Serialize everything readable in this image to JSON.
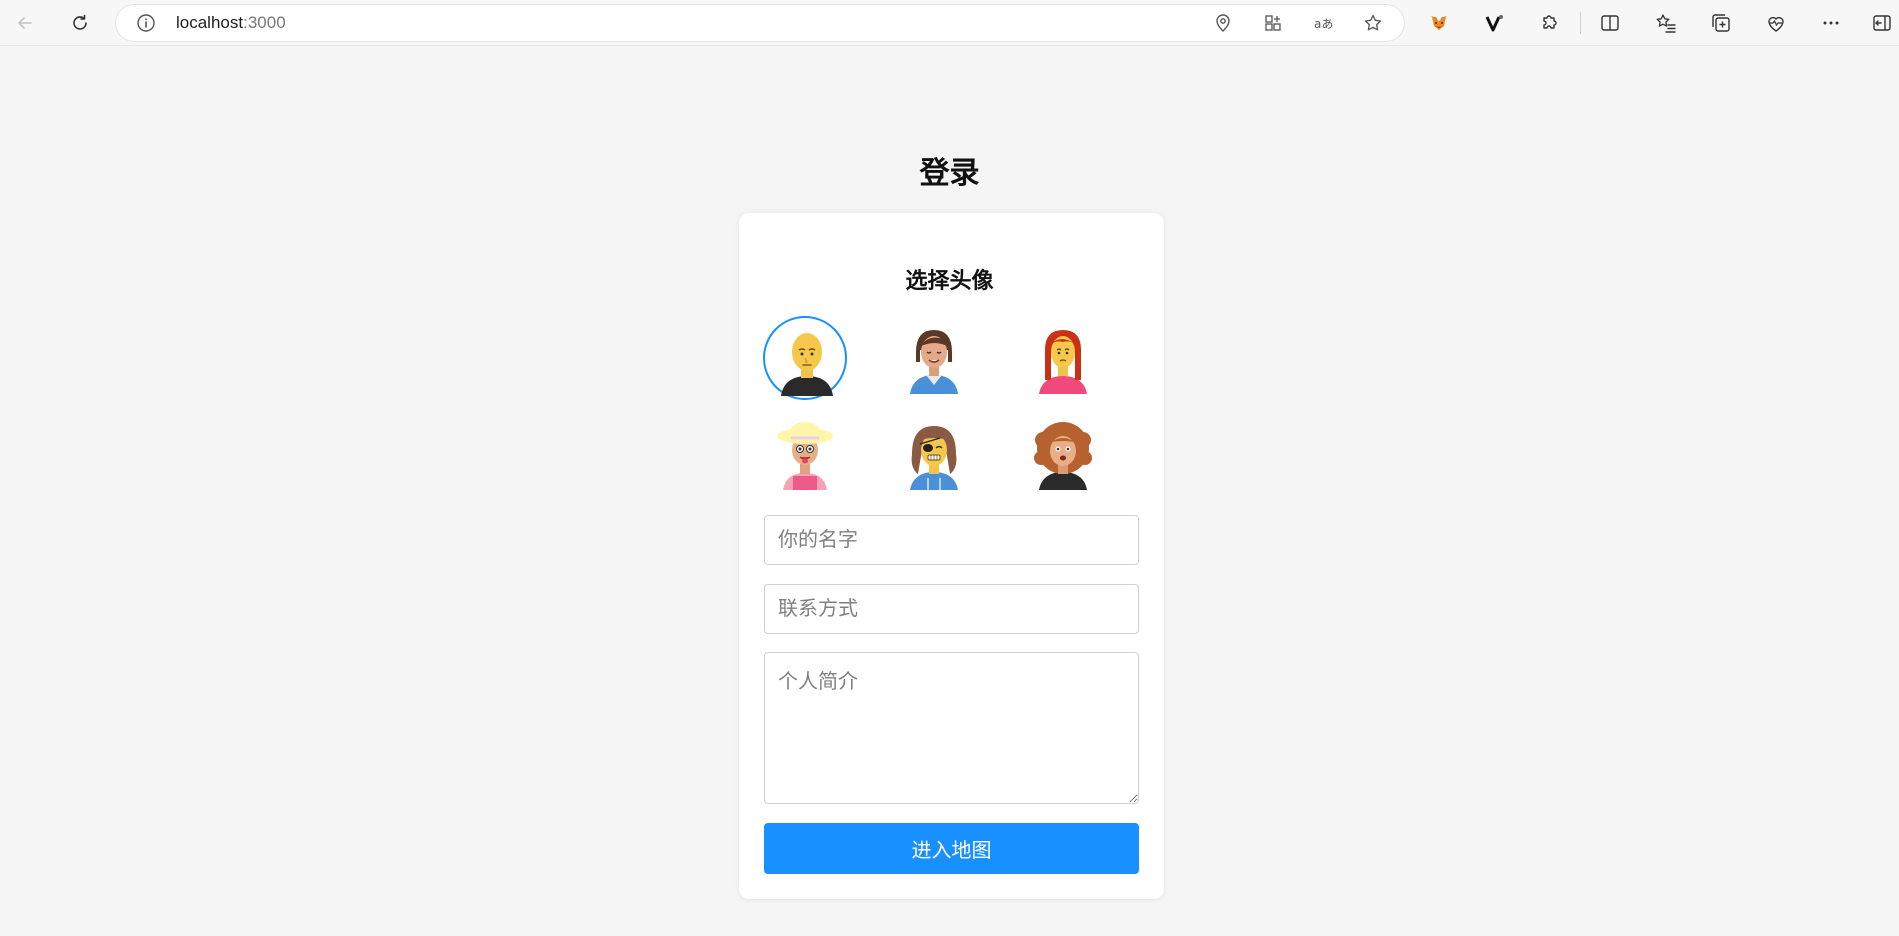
{
  "browser": {
    "url_host": "localhost",
    "url_port": ":3000",
    "icons": [
      "back-icon",
      "refresh-icon",
      "site-info-icon",
      "location-icon",
      "apps-icon",
      "read-aloud-icon",
      "favorite-star-icon",
      "metamask-fox-icon",
      "v-extension-icon",
      "extensions-puzzle-icon",
      "split-screen-icon",
      "favorites-list-icon",
      "collections-icon",
      "browser-essentials-icon",
      "more-icon",
      "sidebar-toggle-icon"
    ]
  },
  "page": {
    "title": "登录",
    "avatar_section_title": "选择头像",
    "avatars": [
      {
        "name": "bald-yellow-avatar",
        "selected": true
      },
      {
        "name": "brown-hair-woman-avatar",
        "selected": false
      },
      {
        "name": "red-hair-woman-avatar",
        "selected": false
      },
      {
        "name": "straw-hat-avatar",
        "selected": false
      },
      {
        "name": "eyepatch-avatar",
        "selected": false
      },
      {
        "name": "curly-hair-avatar",
        "selected": false
      }
    ],
    "name_placeholder": "你的名字",
    "contact_placeholder": "联系方式",
    "bio_placeholder": "个人简介",
    "submit_label": "进入地图"
  },
  "colors": {
    "accent": "#1890ff",
    "background": "#f5f5f5",
    "card": "#ffffff"
  }
}
